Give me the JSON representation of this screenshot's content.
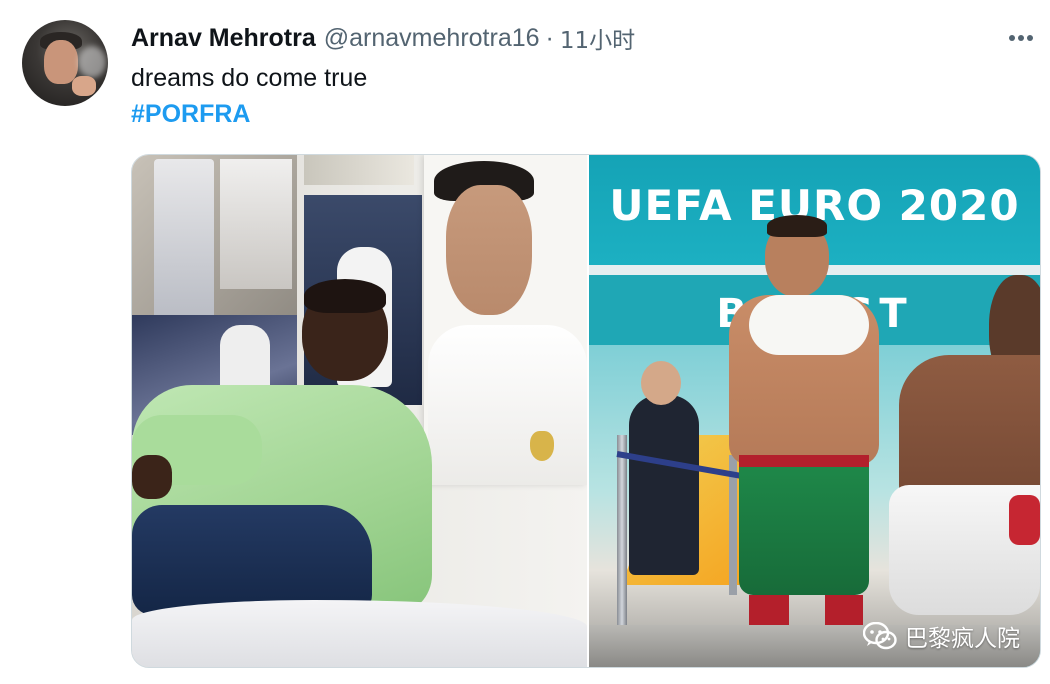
{
  "tweet": {
    "author": {
      "display_name": "Arnav Mehrotra",
      "handle": "@arnavmehrotra16",
      "avatar": "avatar"
    },
    "separator": "·",
    "timestamp": "11小时",
    "more_icon": "more-horizontal-icon",
    "text": "dreams do come true",
    "hashtag": "#PORFRA"
  },
  "media": {
    "left_photo": {
      "subject": "young boy in green hoodie seated beside poster"
    },
    "right_photo": {
      "banner_top": "UEFA EURO 2020",
      "banner_bottom": "BU  EST"
    },
    "watermark": {
      "icon": "wechat-icon",
      "text": "巴黎疯人院"
    }
  },
  "colors": {
    "text_primary": "#0f1419",
    "text_secondary": "#536471",
    "link": "#1d9bf0",
    "border": "#cfd9de"
  }
}
